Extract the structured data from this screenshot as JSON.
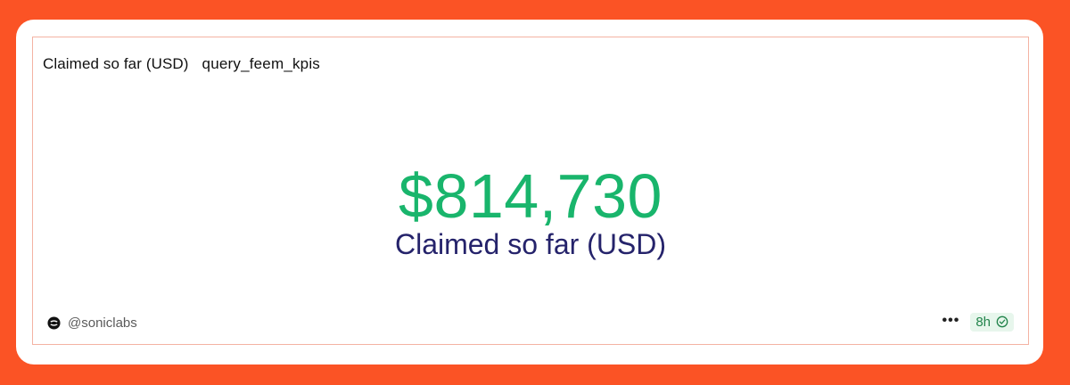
{
  "header": {
    "title": "Claimed so far (USD)",
    "query_name": "query_feem_kpis"
  },
  "counter": {
    "value": "$814,730",
    "label": "Claimed so far (USD)"
  },
  "footer": {
    "author": "@soniclabs",
    "refresh_badge": "8h"
  },
  "icons": {
    "author_logo": "sonic-logo-icon",
    "more": "more-dots-icon",
    "status": "check-circle-icon"
  },
  "colors": {
    "background": "#fb5325",
    "value": "#19b56c",
    "label": "#25236b",
    "badge_bg": "#e7f6ec",
    "badge_text": "#22844b"
  }
}
